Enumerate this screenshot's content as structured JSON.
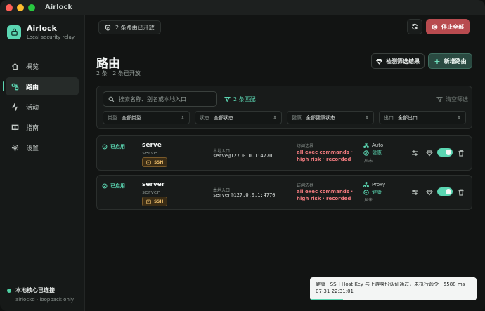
{
  "window": {
    "title": "Airlock"
  },
  "brand": {
    "name": "Airlock",
    "tagline": "Local security relay"
  },
  "sidebar": {
    "items": [
      {
        "label": "概览",
        "icon": "home-icon"
      },
      {
        "label": "路由",
        "icon": "route-icon",
        "active": true
      },
      {
        "label": "活动",
        "icon": "activity-icon"
      },
      {
        "label": "指南",
        "icon": "book-icon"
      },
      {
        "label": "设置",
        "icon": "gear-icon"
      }
    ],
    "connection": {
      "status": "本地核心已连接",
      "detail": "airlockd · loopback only"
    }
  },
  "topbar": {
    "status_chip": "2 条路由已开放",
    "stop_label": "停止全部"
  },
  "page": {
    "title": "路由",
    "subtitle": "2 条 · 2 条已开放",
    "detect_label": "检测筛选结果",
    "add_label": "新增路由"
  },
  "filters": {
    "search_placeholder": "搜索名称、别名或本地入口",
    "match_text": "2 条匹配",
    "clear_label": "清空筛选",
    "selects": [
      {
        "label": "类型",
        "value": "全部类型"
      },
      {
        "label": "状态",
        "value": "全部状态"
      },
      {
        "label": "健康",
        "value": "全部健康状态"
      },
      {
        "label": "出口",
        "value": "全部出口"
      }
    ]
  },
  "routes": [
    {
      "status": "已启用",
      "name": "serve",
      "id": "serve",
      "kind": "SSH",
      "entry_label": "本地入口",
      "entry": "serve@127.0.0.1:4770",
      "policy_label": "访问边界",
      "policy": "all exec commands · high risk · recorded",
      "mode": "Auto",
      "health": "健康",
      "from": "从未",
      "enabled": true
    },
    {
      "status": "已启用",
      "name": "server",
      "id": "server",
      "kind": "SSH",
      "entry_label": "本地入口",
      "entry": "server@127.0.0.1:4770",
      "policy_label": "访问边界",
      "policy": "all exec commands · high risk · recorded",
      "mode": "Proxy",
      "health": "健康",
      "from": "从未",
      "enabled": true
    }
  ],
  "toast": {
    "text": "健康 · SSH Host Key 与上游身份认证通过，未执行命令 · 5588 ms · 07-31 22:31:01",
    "progress": 0.2
  },
  "colors": {
    "accent": "#5bd6b2",
    "danger": "#b84b4f",
    "policy": "#f07a7e",
    "ssh": "#e5b767"
  }
}
